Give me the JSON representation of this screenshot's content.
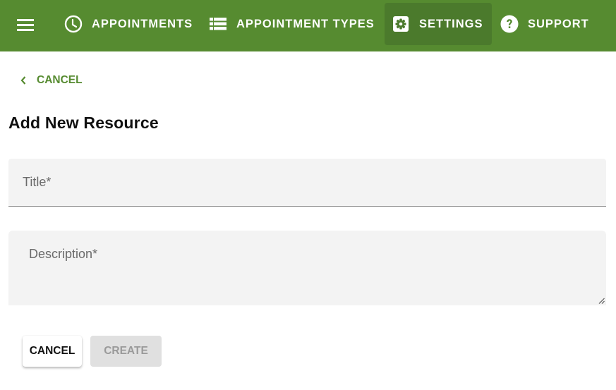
{
  "colors": {
    "brand": "#568b30",
    "nav_active": "#4b7a2c",
    "field_bg": "#f3f3f3",
    "disabled_bg": "#e0e0e0",
    "disabled_text": "#9a9a9a"
  },
  "topbar": {
    "menu_icon": "hamburger-menu-icon",
    "nav": [
      {
        "label": "APPOINTMENTS",
        "icon": "clock-icon",
        "active": false
      },
      {
        "label": "APPOINTMENT TYPES",
        "icon": "list-icon",
        "active": false
      },
      {
        "label": "SETTINGS",
        "icon": "gear-icon",
        "active": true
      },
      {
        "label": "SUPPORT",
        "icon": "help-circle-icon",
        "active": false
      }
    ]
  },
  "back_link": {
    "label": "CANCEL",
    "icon": "chevron-left-icon"
  },
  "page_title": "Add New Resource",
  "form": {
    "title_field": {
      "label": "Title*",
      "value": ""
    },
    "description_field": {
      "label": "Description*",
      "value": ""
    }
  },
  "actions": {
    "cancel_label": "CANCEL",
    "create_label": "CREATE",
    "create_disabled": true
  }
}
